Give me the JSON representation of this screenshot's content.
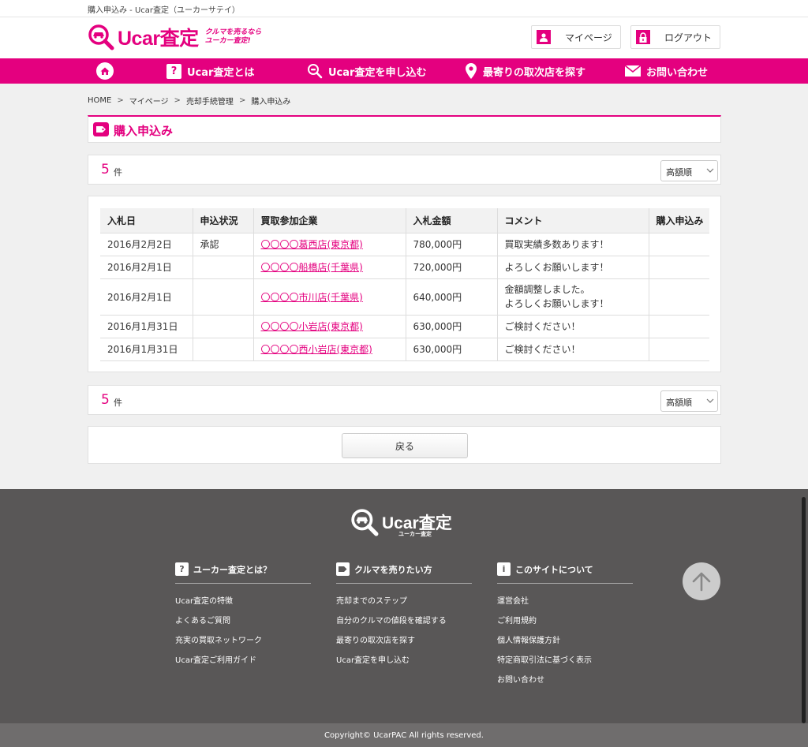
{
  "window": {
    "title": "購入申込み - Ucar査定（ユーカーサテイ）"
  },
  "header": {
    "logo_text": "Ucar査定",
    "tagline_1": "クルマを売るなら",
    "tagline_2": "ユーカー査定!",
    "mypage_label": "マイページ",
    "logout_label": "ログアウト"
  },
  "nav": {
    "items": [
      {
        "label": "Ucar査定とは"
      },
      {
        "label": "Ucar査定を申し込む"
      },
      {
        "label": "最寄りの取次店を探す"
      },
      {
        "label": "お問い合わせ"
      }
    ]
  },
  "breadcrumb": [
    "HOME",
    "マイページ",
    "売却手続管理",
    "購入申込み"
  ],
  "page_heading": "購入申込み",
  "result_count": {
    "number": "5",
    "unit": "件"
  },
  "sort": {
    "selected": "高額順"
  },
  "table": {
    "headers": [
      "入札日",
      "申込状況",
      "買取参加企業",
      "入札金額",
      "コメント",
      "購入申込み"
    ],
    "rows": [
      {
        "date": "2016月2月2日",
        "status": "承認",
        "company": "〇〇〇〇葛西店(東京都)",
        "amount": "780,000円",
        "comment_1": "買取実績多数あります！",
        "comment_2": "",
        "apply": ""
      },
      {
        "date": "2016月2月1日",
        "status": "",
        "company": "〇〇〇〇船橋店(千葉県)",
        "amount": "720,000円",
        "comment_1": "よろしくお願いします！",
        "comment_2": "",
        "apply": ""
      },
      {
        "date": "2016月2月1日",
        "status": "",
        "company": "〇〇〇〇市川店(千葉県)",
        "amount": "640,000円",
        "comment_1": "金額調整しました。",
        "comment_2": "よろしくお願いします！",
        "apply": ""
      },
      {
        "date": "2016月1月31日",
        "status": "",
        "company": "〇〇〇〇小岩店(東京都)",
        "amount": "630,000円",
        "comment_1": "ご検討ください！",
        "comment_2": "",
        "apply": ""
      },
      {
        "date": "2016月1月31日",
        "status": "",
        "company": "〇〇〇〇西小岩店(東京都)",
        "amount": "630,000円",
        "comment_1": "ご検討ください！",
        "comment_2": "",
        "apply": ""
      }
    ]
  },
  "back_label": "戻る",
  "footer": {
    "logo_text": "Ucar査定",
    "logo_sub": "ユーカー査定",
    "columns": [
      {
        "icon": "?",
        "title": "ユーカー査定とは？",
        "links": [
          "Ucar査定の特徴",
          "よくあるご質問",
          "充実の買取ネットワーク",
          "Ucar査定ご利用ガイド"
        ]
      },
      {
        "icon": "",
        "title": "クルマを売りたい方",
        "links": [
          "売却までのステップ",
          "自分のクルマの値段を確認する",
          "最寄りの取次店を探す",
          "Ucar査定を申し込む"
        ]
      },
      {
        "icon": "i",
        "title": "このサイトについて",
        "links": [
          "運営会社",
          "ご利用規約",
          "個人情報保護方針",
          "特定商取引法に基づく表示",
          "お問い合わせ"
        ]
      }
    ],
    "copyright": "Copyright© UcarPAC All rights reserved."
  },
  "colors": {
    "brand": "#e4007f",
    "footer_bg": "#595757",
    "page_bg": "#f0f0f0"
  },
  "icons": [
    "magnifier-car-logo-icon",
    "person-icon",
    "lock-icon",
    "home-icon",
    "question-icon",
    "search-icon",
    "pin-icon",
    "mail-icon",
    "tag-icon",
    "chevron-down-icon",
    "arrow-up-icon"
  ]
}
